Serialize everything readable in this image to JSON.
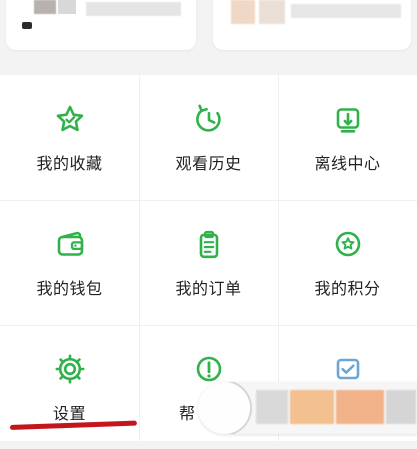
{
  "theme": {
    "accent": "#2fb24a",
    "text": "#222222",
    "underline": "#c4151b"
  },
  "menu": {
    "rows": [
      [
        {
          "id": "favorites",
          "label": "我的收藏",
          "icon": "star-icon"
        },
        {
          "id": "history",
          "label": "观看历史",
          "icon": "history-clock-icon"
        },
        {
          "id": "offline",
          "label": "离线中心",
          "icon": "download-box-icon"
        }
      ],
      [
        {
          "id": "wallet",
          "label": "我的钱包",
          "icon": "wallet-icon"
        },
        {
          "id": "orders",
          "label": "我的订单",
          "icon": "order-clipboard-icon"
        },
        {
          "id": "points",
          "label": "我的积分",
          "icon": "points-star-circle-icon"
        }
      ],
      [
        {
          "id": "settings",
          "label": "设置",
          "icon": "gear-icon"
        },
        {
          "id": "help",
          "label": "帮",
          "icon": "help-exclamation-icon"
        },
        {
          "id": "checkin",
          "label": "",
          "icon": "checkbox-icon"
        }
      ]
    ]
  }
}
